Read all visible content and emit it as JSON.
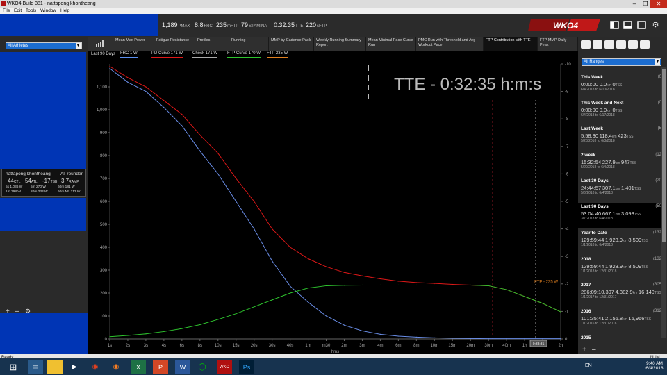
{
  "window": {
    "title": "WKO4 Build 381 - nattapong khontheang",
    "minimize": "–",
    "maximize": "❐",
    "close": "✕"
  },
  "menu": [
    "File",
    "Edit",
    "Tools",
    "Window",
    "Help"
  ],
  "header": {
    "metrics": [
      {
        "value": "1,189",
        "unit": "PMAX"
      },
      {
        "value": "8.8",
        "unit": "FRC"
      },
      {
        "value": "235",
        "unit": "mFTP"
      },
      {
        "value": "79",
        "unit": "STAMINA"
      },
      {
        "value": "0:32:35",
        "unit": "TTE"
      },
      {
        "value": "220",
        "unit": "sFTP"
      }
    ],
    "logo_text": "WKO4"
  },
  "left": {
    "athlete_filter": "All Athletes",
    "card": {
      "name": "nattapong khontheang",
      "type": "All-rounder",
      "ctl": "44",
      "ctl_unit": "CTL",
      "atl": "54",
      "atl_unit": "ATL",
      "tsb": "-17",
      "tsb_unit": "TSB",
      "ramp": "3.7",
      "ramp_unit": "RAMP",
      "r1": [
        "5s 1,036 W",
        "5m 270 W",
        "60m 181 W"
      ],
      "r2": [
        "1m 398 W",
        "20m 233 W",
        "60m NP 213 W"
      ]
    },
    "bottom_icons": [
      "+",
      "–",
      "⚙"
    ]
  },
  "tabs": [
    {
      "label": "Mean Max Power"
    },
    {
      "label": "Fatigue Resistance"
    },
    {
      "label": "Profiles"
    },
    {
      "label": "Running"
    },
    {
      "label": "MMP by Cadence Pack"
    },
    {
      "label": "Weekly Running Summary Report"
    },
    {
      "label": "Mean Minimal Pace Curve Run"
    },
    {
      "label": "PMC Run with Threshold and Avg Workout Pace"
    },
    {
      "label": "FTP Contribution with TTE"
    },
    {
      "label": "FTP MMP Daily Peak"
    }
  ],
  "legend": {
    "range": "Last 90 Days",
    "items": [
      {
        "label": "FRC 1 W",
        "color": "#5b8ff0"
      },
      {
        "label": "PD Curve 171 W",
        "color": "#e01818"
      },
      {
        "label": "Check 171 W",
        "color": "#aaaaaa"
      },
      {
        "label": "FTP Curve 170 W",
        "color": "#2ec42e"
      },
      {
        "label": "FTP 235 W",
        "color": "#e08020"
      }
    ]
  },
  "chart_data": {
    "type": "line",
    "annotation": "TTE - 0:32:35 h:m:s",
    "xlabel": "hms",
    "ftp_label": "FTP - 235 W",
    "tte_marker": "0:38:31",
    "x_ticks": [
      "1s",
      "2s",
      "3s",
      "4s",
      "6s",
      "8s",
      "10s",
      "15s",
      "20s",
      "30s",
      "40s",
      "1m",
      "m30",
      "2m",
      "3m",
      "4m",
      "6m",
      "8m",
      "10m",
      "15m",
      "20m",
      "30m",
      "40m",
      "1h",
      "h30",
      "2h"
    ],
    "y_left_ticks": [
      "0",
      "100",
      "200",
      "300",
      "400",
      "500",
      "600",
      "700",
      "800",
      "900",
      "1,000",
      "1,100"
    ],
    "y_right_ticks": [
      "0",
      "-1",
      "-2",
      "-3",
      "-4",
      "-5",
      "-6",
      "-7",
      "-8",
      "-9",
      "-10"
    ],
    "ylim": [
      0,
      1200
    ],
    "y2lim": [
      0,
      -10
    ],
    "series": [
      {
        "name": "FRC",
        "color": "#6a8ee8",
        "x_index": [
          0,
          1,
          2,
          3,
          4,
          5,
          6,
          7,
          8,
          9,
          10,
          11,
          12,
          13,
          14,
          15,
          16,
          17,
          18,
          19,
          20,
          21,
          22,
          23,
          24,
          25
        ],
        "values": [
          1180,
          1120,
          1080,
          1010,
          930,
          820,
          720,
          600,
          480,
          340,
          230,
          160,
          100,
          60,
          35,
          20,
          12,
          8,
          5,
          3,
          2,
          1,
          1,
          1,
          1,
          1
        ]
      },
      {
        "name": "PD Curve",
        "color": "#e01818",
        "x_index": [
          0,
          1,
          2,
          3,
          4,
          5,
          6,
          7,
          8,
          9,
          10,
          11,
          12,
          13,
          14,
          15,
          16,
          17,
          18,
          19,
          20,
          21,
          22,
          23,
          24,
          25
        ],
        "values": [
          1189,
          1140,
          1100,
          1040,
          980,
          890,
          810,
          700,
          600,
          480,
          400,
          350,
          315,
          290,
          275,
          262,
          252,
          246,
          242,
          238,
          235,
          232,
          215,
          185,
          155,
          118
        ]
      },
      {
        "name": "FTP Curve",
        "color": "#2ec42e",
        "x_index": [
          0,
          1,
          2,
          3,
          4,
          5,
          6,
          7,
          8,
          9,
          10,
          11,
          12,
          13,
          14,
          15,
          16,
          17,
          18,
          19,
          20,
          21,
          22,
          23,
          24,
          25
        ],
        "values": [
          10,
          15,
          22,
          32,
          45,
          62,
          85,
          110,
          140,
          170,
          200,
          222,
          232,
          234,
          235,
          235,
          235,
          235,
          235,
          235,
          235,
          232,
          215,
          185,
          155,
          118
        ]
      }
    ],
    "ftp_value": 235,
    "vline_red_index": 21,
    "vline_white_index": 24
  },
  "right": {
    "filter": "All Ranges",
    "ranges": [
      {
        "name": "This Week",
        "count": "(0",
        "dur": "0:00:00",
        "dist": "0.0",
        "dist_u": "km",
        "tss": "0",
        "tss_u": "TSS",
        "dates": "6/4/2018  to  6/10/2018"
      },
      {
        "name": "This Week and Next",
        "count": "(0",
        "dur": "0:00:00",
        "dist": "0.0",
        "dist_u": "km",
        "tss": "0",
        "tss_u": "TSS",
        "dates": "6/4/2018  to  6/17/2018"
      },
      {
        "name": "Last Week",
        "count": "(5",
        "dur": "5:58:30",
        "dist": "118.4",
        "dist_u": "km",
        "tss": "423",
        "tss_u": "TSS",
        "dates": "5/28/2018  to  6/3/2018"
      },
      {
        "name": "2 week",
        "count": "(12",
        "dur": "15:32:54",
        "dist": "227.9",
        "dist_u": "km",
        "tss": "947",
        "tss_u": "TSS",
        "dates": "5/20/2018  to  6/4/2018"
      },
      {
        "name": "Last 30 Days",
        "count": "(20",
        "dur": "24:44:57",
        "dist": "307.1",
        "dist_u": "km",
        "tss": "1,401",
        "tss_u": "TSS",
        "dates": "5/6/2018  to  6/4/2018"
      },
      {
        "name": "Last 90 Days",
        "count": "(50",
        "dur": "53:04:40",
        "dist": "667.1",
        "dist_u": "km",
        "tss": "3,093",
        "tss_u": "TSS",
        "dates": "3/7/2018  to  6/4/2018"
      },
      {
        "name": "Year to Date",
        "count": "(132",
        "dur": "129:59:44",
        "dist": "1,923.9",
        "dist_u": "km",
        "tss": "8,509",
        "tss_u": "TSS",
        "dates": "1/1/2018  to  6/4/2018"
      },
      {
        "name": "2018",
        "count": "(132",
        "dur": "129:59:44",
        "dist": "1,923.9",
        "dist_u": "km",
        "tss": "8,509",
        "tss_u": "TSS",
        "dates": "1/1/2018  to  12/31/2018"
      },
      {
        "name": "2017",
        "count": "(305",
        "dur": "286:09:10.397",
        "dist": "4,382.9",
        "dist_u": "km",
        "tss": "16,140",
        "tss_u": "TSS",
        "dates": "1/1/2017  to  12/31/2017"
      },
      {
        "name": "2016",
        "count": "(312",
        "dur": "101:35:41",
        "dist": "2,156.8",
        "dist_u": "km",
        "tss": "15,966",
        "tss_u": "TSS",
        "dates": "1/1/2016  to  12/31/2016"
      },
      {
        "name": "2015",
        "count": "",
        "dur": "",
        "dist": "",
        "dist_u": "",
        "tss": "",
        "tss_u": "",
        "dates": ""
      }
    ],
    "selected_index": 5,
    "bottom_add": "+",
    "bottom_remove": "–"
  },
  "status": {
    "text": "Ready",
    "num": "NUM"
  },
  "taskbar": {
    "time": "9:40 AM",
    "date": "6/4/2018",
    "lang": "EN"
  }
}
